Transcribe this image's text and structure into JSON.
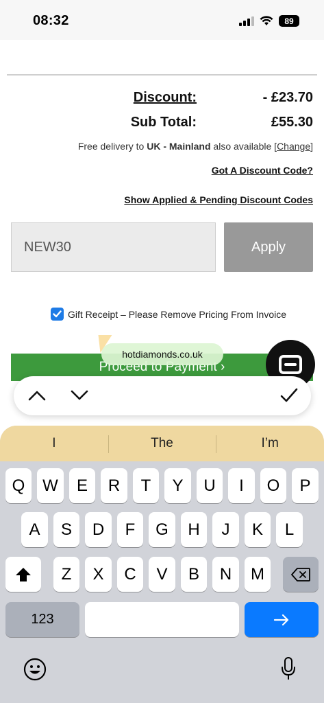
{
  "status_bar": {
    "time": "08:32",
    "battery": "89"
  },
  "cart": {
    "faded_header": "",
    "discount_label": "Discount:",
    "discount_value": "- £23.70",
    "subtotal_label": "Sub Total:",
    "subtotal_value": "£55.30",
    "delivery_prefix": "Free delivery to ",
    "delivery_region": "UK - Mainland",
    "delivery_suffix": " also available [",
    "delivery_change": "Change",
    "delivery_end": "]",
    "discount_code_link": "Got A Discount Code?",
    "applied_codes_link": "Show Applied & Pending Discount Codes",
    "code_input_value": "NEW30",
    "apply_label": "Apply",
    "gift_receipt_label": "Gift Receipt – Please Remove Pricing From Invoice",
    "gift_receipt_checked": true,
    "proceed_label": "Proceed to Payment ›"
  },
  "browser": {
    "url": "hotdiamonds.co.uk"
  },
  "accessory": {
    "up": "chevron-up-icon",
    "down": "chevron-down-icon",
    "done": "checkmark-icon"
  },
  "keyboard": {
    "suggestions": [
      "I",
      "The",
      "I’m"
    ],
    "row1": [
      "Q",
      "W",
      "E",
      "R",
      "T",
      "Y",
      "U",
      "I",
      "O",
      "P"
    ],
    "row2": [
      "A",
      "S",
      "D",
      "F",
      "G",
      "H",
      "J",
      "K",
      "L"
    ],
    "row3": [
      "Z",
      "X",
      "C",
      "V",
      "B",
      "N",
      "M"
    ],
    "numbers_label": "123",
    "shift_icon": "shift-icon",
    "delete_icon": "delete-icon",
    "return_icon": "arrow-right-icon",
    "emoji_icon": "emoji-icon",
    "mic_icon": "microphone-icon"
  },
  "colors": {
    "proceed_green": "#3d9a3d",
    "apply_gray": "#999999",
    "keyboard_bg": "#d1d3d9",
    "suggestion_bar": "#efd8a0",
    "return_blue": "#0a7aff",
    "checkbox_blue": "#1e7be6"
  }
}
